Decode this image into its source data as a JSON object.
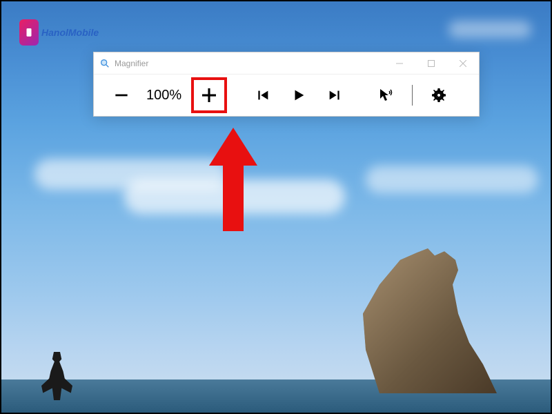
{
  "watermark": {
    "text": "HanolMobile"
  },
  "magnifier": {
    "title": "Magnifier",
    "zoom_level": "100%",
    "controls": {
      "minimize": "Minimize",
      "maximize": "Maximize",
      "close": "Close"
    },
    "toolbar": {
      "zoom_out": "−",
      "zoom_in": "+",
      "previous": "Previous",
      "play": "Play",
      "next": "Next",
      "read_aloud": "Read aloud cursor",
      "settings": "Settings"
    }
  },
  "annotation": {
    "highlight_target": "zoom-in-button",
    "arrow_color": "#e81010",
    "highlight_color": "#e81010"
  }
}
